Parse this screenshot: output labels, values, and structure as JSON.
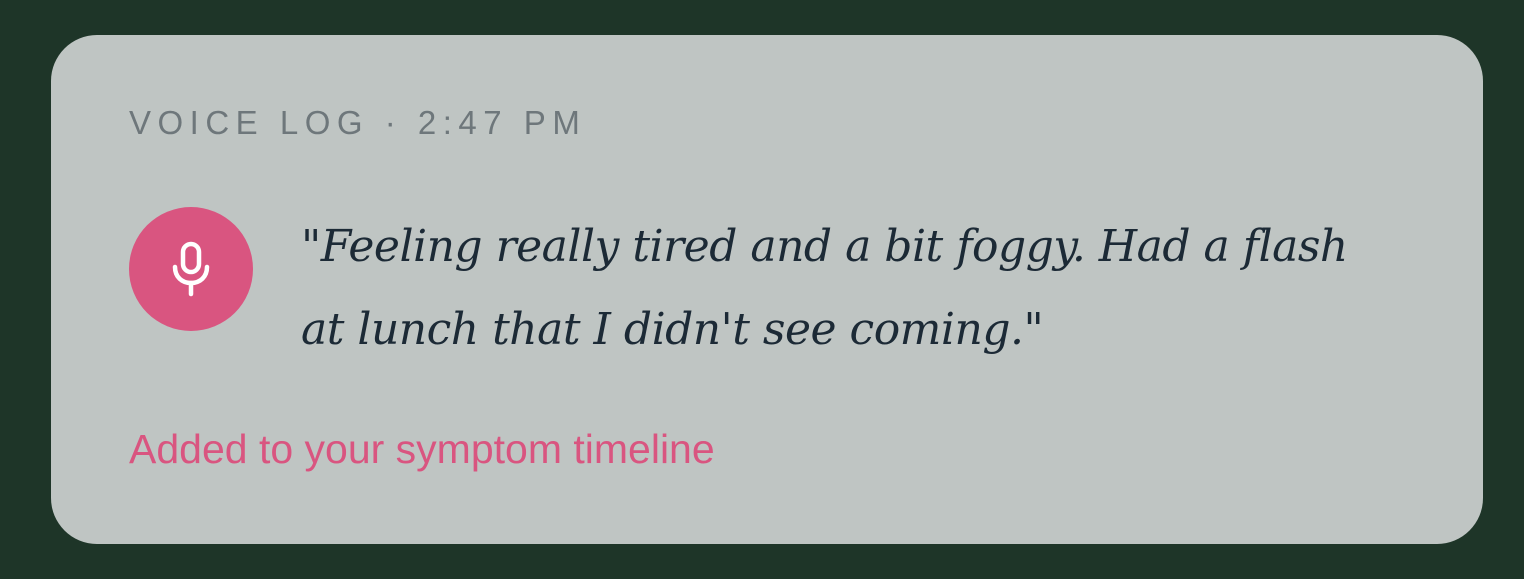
{
  "card": {
    "label": "VOICE LOG",
    "separator": "·",
    "time": "2:47 PM",
    "quote": "\"Feeling really tired and a bit foggy. Had a flash at lunch that I didn't see coming.\"",
    "status": "Added to your symptom timeline",
    "icon": "microphone-icon"
  },
  "colors": {
    "background": "#1e3528",
    "card": "#bfc5c3",
    "accent": "#d95580",
    "quote_text": "#1c2a36",
    "meta_text": "#6e777b"
  }
}
